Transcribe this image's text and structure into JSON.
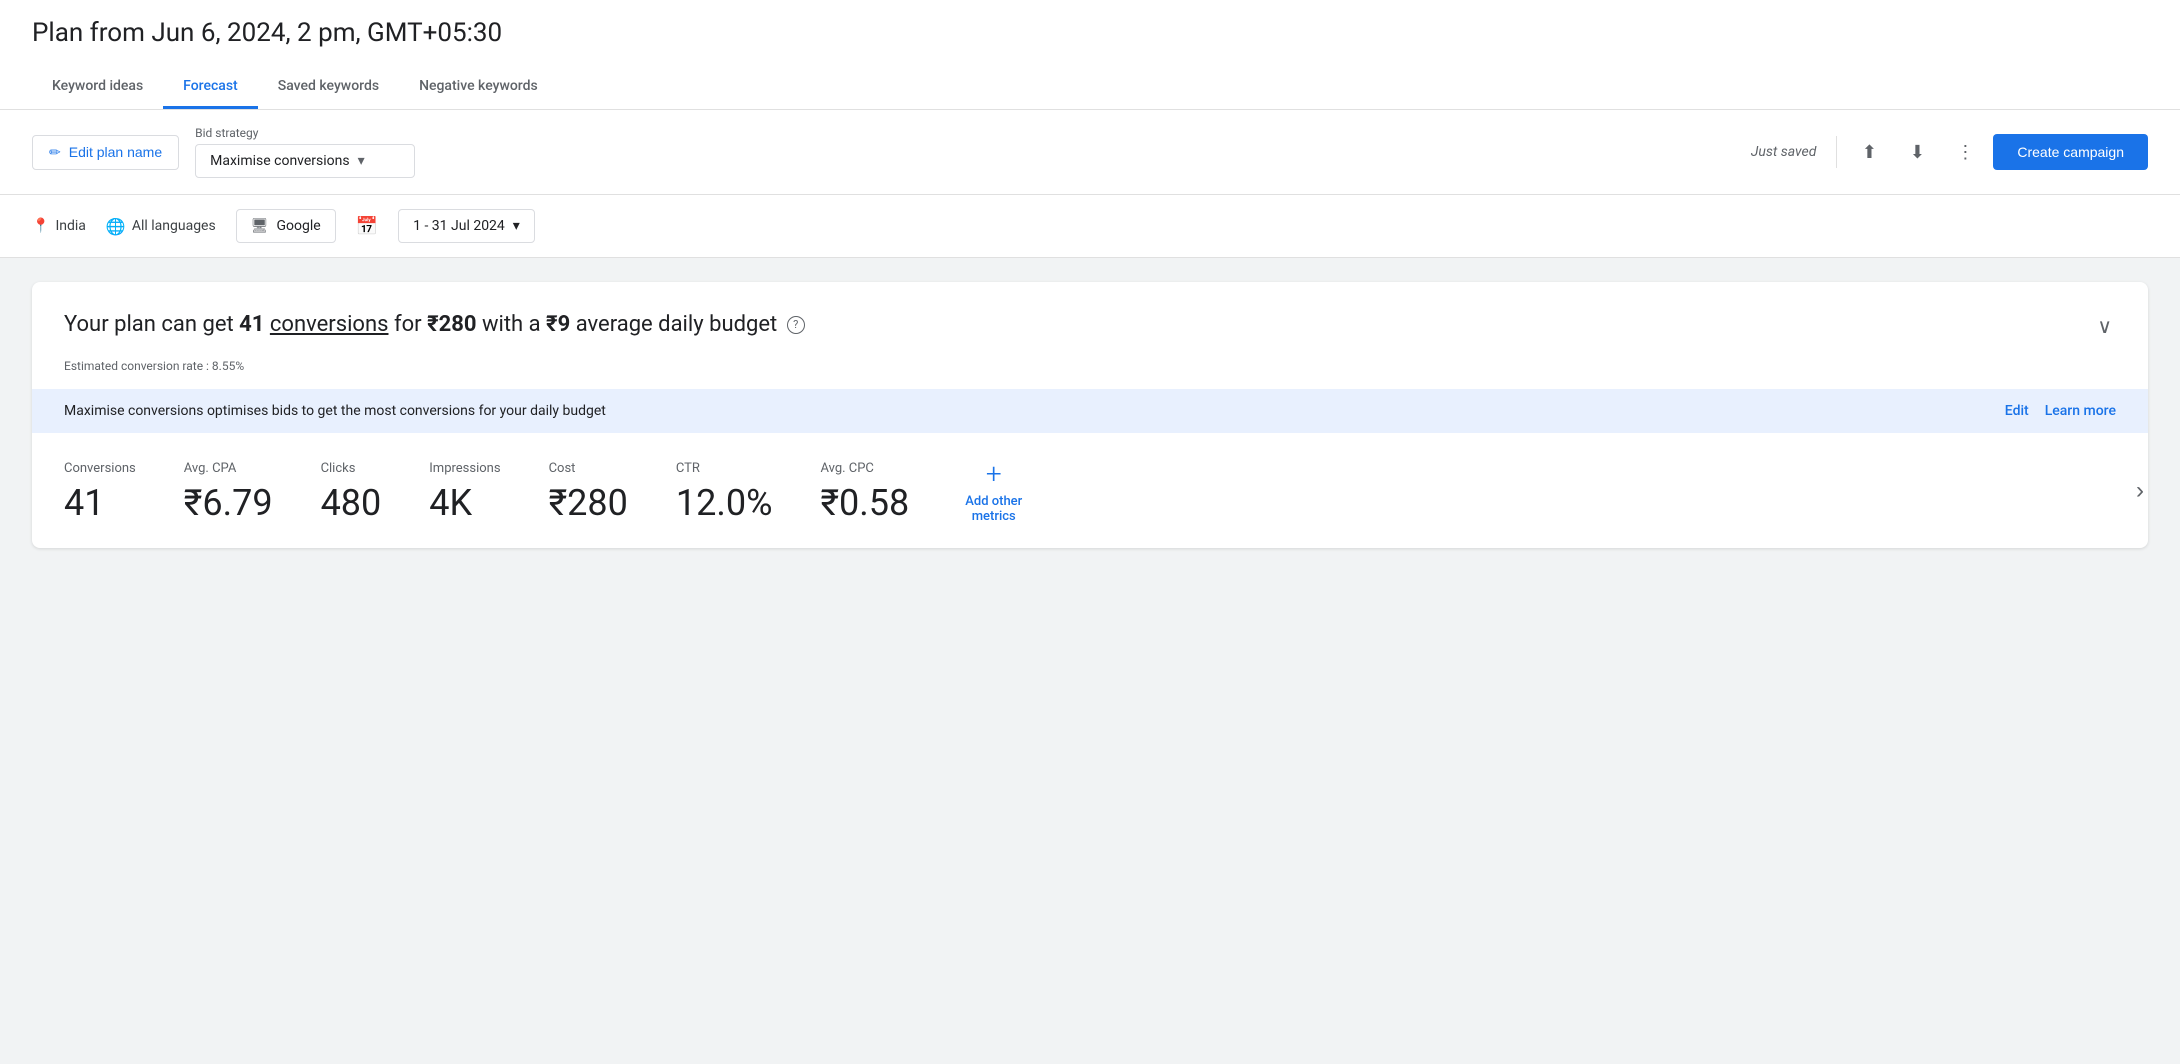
{
  "header": {
    "plan_title": "Plan from Jun 6, 2024, 2 pm, GMT+05:30"
  },
  "tabs": [
    {
      "id": "keyword-ideas",
      "label": "Keyword ideas",
      "active": false
    },
    {
      "id": "forecast",
      "label": "Forecast",
      "active": true
    },
    {
      "id": "saved-keywords",
      "label": "Saved keywords",
      "active": false
    },
    {
      "id": "negative-keywords",
      "label": "Negative keywords",
      "active": false
    }
  ],
  "toolbar": {
    "edit_plan_label": "Edit plan name",
    "bid_strategy_label": "Bid strategy",
    "bid_strategy_value": "Maximise conversions",
    "just_saved_text": "Just saved",
    "create_campaign_label": "Create campaign"
  },
  "filters": {
    "location": "India",
    "language": "All languages",
    "network": "Google",
    "date_range": "1 - 31 Jul 2024"
  },
  "summary": {
    "prefix": "Your plan can get",
    "conversions_count": "41",
    "conversions_label": "conversions",
    "for_text": "for",
    "cost": "₹280",
    "with_text": "with a",
    "daily_budget": "₹9",
    "suffix": "average daily budget",
    "estimated_rate": "Estimated conversion rate : 8.55%",
    "chevron": "∨"
  },
  "info_banner": {
    "text": "Maximise conversions optimises bids to get the most conversions for your daily budget",
    "edit_label": "Edit",
    "learn_more_label": "Learn more"
  },
  "metrics": [
    {
      "id": "conversions",
      "label": "Conversions",
      "value": "41"
    },
    {
      "id": "avg-cpa",
      "label": "Avg. CPA",
      "value": "₹6.79"
    },
    {
      "id": "clicks",
      "label": "Clicks",
      "value": "480"
    },
    {
      "id": "impressions",
      "label": "Impressions",
      "value": "4K"
    },
    {
      "id": "cost",
      "label": "Cost",
      "value": "₹280"
    },
    {
      "id": "ctr",
      "label": "CTR",
      "value": "12.0%"
    },
    {
      "id": "avg-cpc",
      "label": "Avg. CPC",
      "value": "₹0.58"
    }
  ],
  "add_metrics": {
    "label": "Add other\nmetrics",
    "plus": "+"
  },
  "icons": {
    "edit": "✏",
    "location": "📍",
    "language": "🌐",
    "network": "🖥",
    "calendar": "📅",
    "share": "⬆",
    "download": "⬇",
    "more": "⋮",
    "chevron_down": "▾",
    "chevron_right": "›",
    "help": "?"
  }
}
